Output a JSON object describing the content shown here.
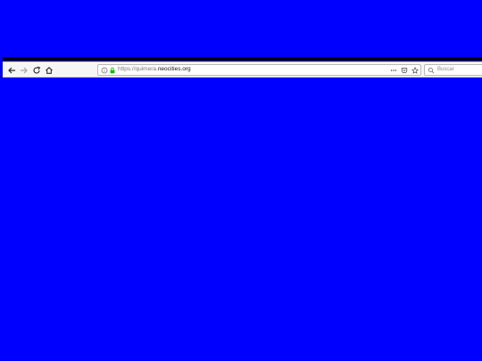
{
  "browser": {
    "url_prefix": "https://quimera.",
    "url_domain": "neocities.org",
    "search_placeholder": "Buscar",
    "page_background": "#0000ff",
    "secure_color": "#12bc00"
  }
}
